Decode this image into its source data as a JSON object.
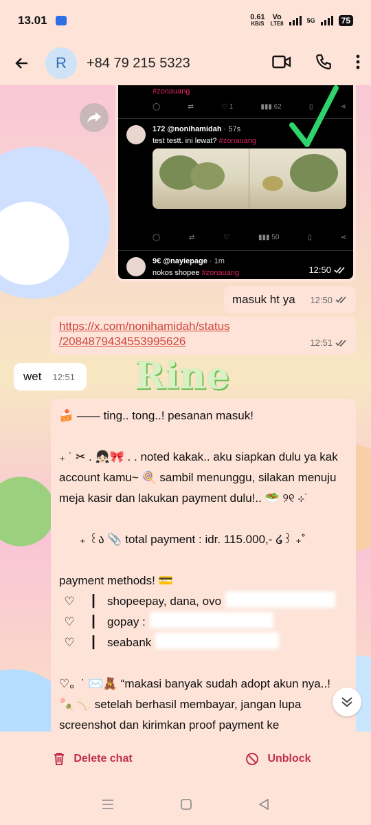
{
  "status_bar": {
    "time": "13.01",
    "net_speed": "0.61",
    "net_unit": "KB/S",
    "vo_label": "Vo",
    "lte_label": "LTE8",
    "fiveg_label": "5G",
    "battery": "75"
  },
  "header": {
    "avatar_letter": "R",
    "contact": "+84 79 215 5323"
  },
  "tweet": {
    "top_hashtag": "#zonauang",
    "row1_likes": "1",
    "row1_views": "62",
    "author1": "172 @nonihamidah",
    "author1_time": "· 57s",
    "text1": "test testt. ini lewat? ",
    "text1_tag": "#zonauang",
    "row2_views": "50",
    "author2": "9€ @nayiepage",
    "author2_time": "· 1m",
    "text2": "nokos shopee ",
    "text2_tag": "#zonauang",
    "time": "12:50"
  },
  "messages": {
    "m1_text": "masuk ht ya",
    "m1_time": "12:50",
    "m2_link": "https://x.com/nonihamidah/status/2084879434553995626",
    "m2_link_line1": "https://x.com/nonihamidah/status",
    "m2_link_line2": "/2084879434553995626",
    "m2_time": "12:51",
    "m3_text": "wet",
    "m3_time": "12:51"
  },
  "long_message": {
    "line1": "🍰 ——  ting.. tong..! pesanan masuk!",
    "line2": "₊ ˙ ✂︎ . 👧🏻🎀 . . noted kakak.. aku siapkan dulu ya kak account kamu~ 🍭 sambil menunggu, silakan menuju meja kasir dan lakukan payment dulu!.. 🥗 ୨୧ ⊹˙",
    "line3": "₊ ꒰ა 📎 total payment : idr. 115.000,- ໒꒱ ₊˚",
    "line4": "payment methods! 💳",
    "pm1": "shopeepay, dana, ovo",
    "pm2": "gopay :",
    "pm3": "seabank",
    "heart": "♡",
    "bar": "┃",
    "line5": "♡。˙ ✉️🧸  “makasi banyak sudah adopt akun nya..! 🍡 🦴 setelah berhasil membayar, jangan lupa screenshot dan kirimkan proof payment ke"
  },
  "bg_text": "Rine",
  "actions": {
    "delete": "Delete chat",
    "unblock": "Unblock"
  },
  "colors": {
    "accent": "#c2304b",
    "bubble": "#fde3d8",
    "link": "#d0453d"
  }
}
